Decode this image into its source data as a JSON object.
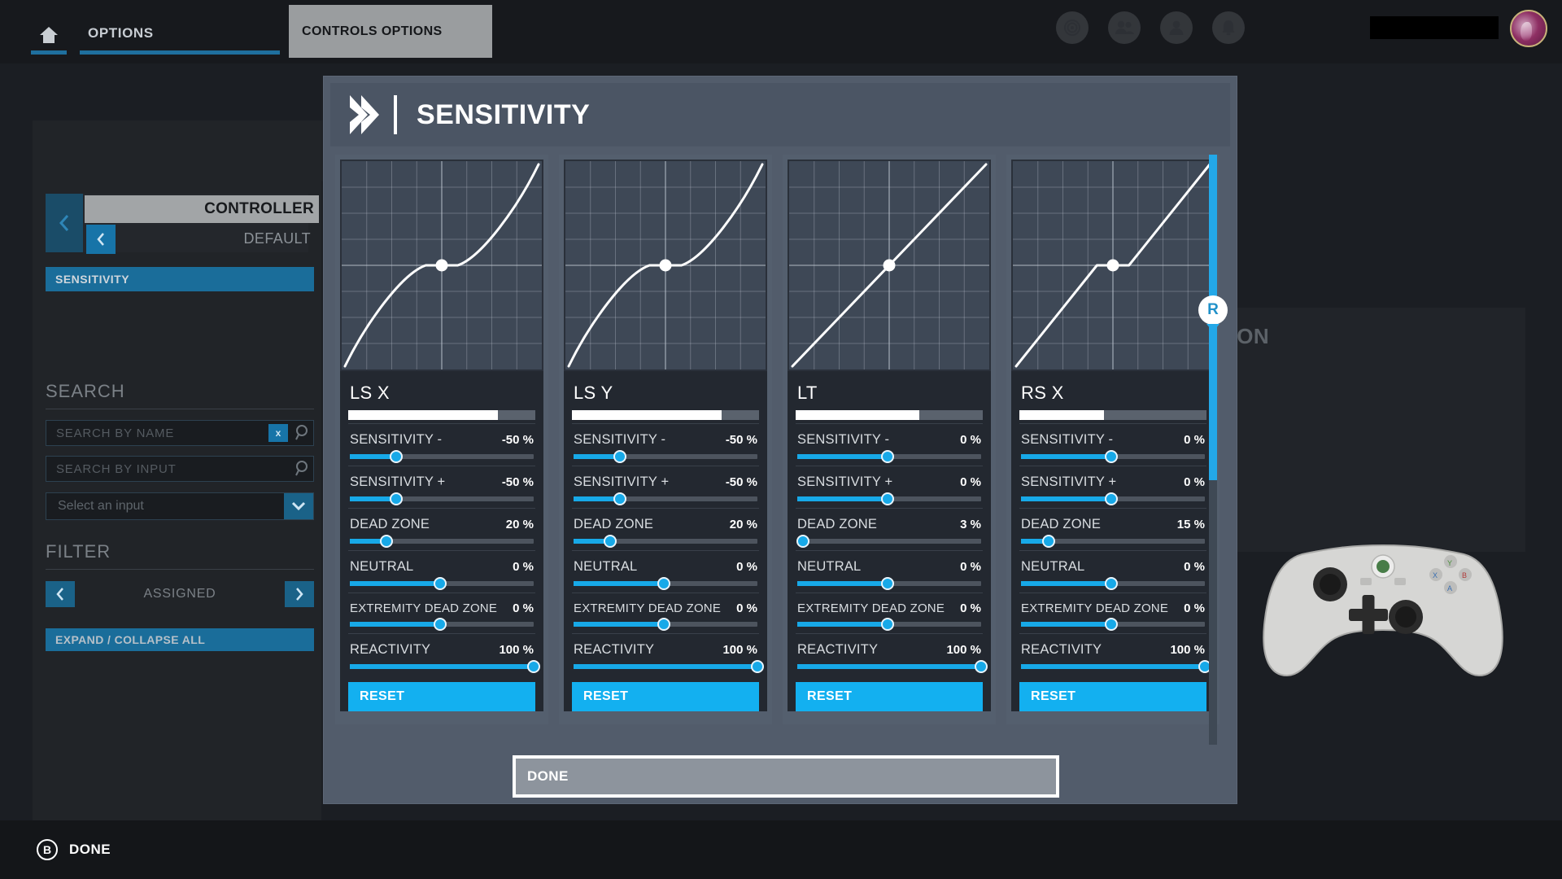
{
  "topbar": {
    "home_icon": "home-icon",
    "options_label": "OPTIONS",
    "active_tab_label": "CONTROLS OPTIONS",
    "icons": [
      "target-icon",
      "friends-icon",
      "profile-icon",
      "notification-icon"
    ]
  },
  "background": {
    "page_title": "CONTROLS O",
    "controller_label": "CONTROLLER",
    "preset_label": "DEFAULT",
    "sensitivity_label": "SENSITIVITY",
    "search_heading": "SEARCH",
    "search_by_name_placeholder": "SEARCH BY NAME",
    "search_by_input_placeholder": "SEARCH BY INPUT",
    "clear_label": "x",
    "select_input_placeholder": "Select an input",
    "filter_heading": "FILTER",
    "filter_value": "ASSIGNED",
    "expand_collapse_label": "EXPAND / COLLAPSE ALL",
    "description_label": "SCRIPTION"
  },
  "modal": {
    "title": "SENSITIVITY",
    "done_label": "DONE",
    "reset_label": "RESET",
    "scroll_hint": "R",
    "rows": [
      {
        "key": "sensitivity_minus",
        "label": "SENSITIVITY -"
      },
      {
        "key": "sensitivity_plus",
        "label": "SENSITIVITY +"
      },
      {
        "key": "dead_zone",
        "label": "DEAD ZONE"
      },
      {
        "key": "neutral",
        "label": "NEUTRAL"
      },
      {
        "key": "extremity_dead_zone",
        "label": "EXTREMITY DEAD ZONE"
      },
      {
        "key": "reactivity",
        "label": "REACTIVITY"
      }
    ],
    "cards": [
      {
        "name": "LS X",
        "meter_percent": 80,
        "values": {
          "sensitivity_minus": "-50 %",
          "sensitivity_plus": "-50 %",
          "dead_zone": "20 %",
          "neutral": "0 %",
          "extremity_dead_zone": "0 %",
          "reactivity": "100 %"
        },
        "knobs": {
          "sensitivity_minus": 25,
          "sensitivity_plus": 25,
          "dead_zone": 20,
          "neutral": 49,
          "extremity_dead_zone": 49,
          "reactivity": 100
        },
        "curve": "concave",
        "node_x": 0.5,
        "node_y": 0.5
      },
      {
        "name": "LS Y",
        "meter_percent": 80,
        "values": {
          "sensitivity_minus": "-50 %",
          "sensitivity_plus": "-50 %",
          "dead_zone": "20 %",
          "neutral": "0 %",
          "extremity_dead_zone": "0 %",
          "reactivity": "100 %"
        },
        "knobs": {
          "sensitivity_minus": 25,
          "sensitivity_plus": 25,
          "dead_zone": 20,
          "neutral": 49,
          "extremity_dead_zone": 49,
          "reactivity": 100
        },
        "curve": "concave",
        "node_x": 0.5,
        "node_y": 0.5
      },
      {
        "name": "LT",
        "meter_percent": 66,
        "values": {
          "sensitivity_minus": "0 %",
          "sensitivity_plus": "0 %",
          "dead_zone": "3 %",
          "neutral": "0 %",
          "extremity_dead_zone": "0 %",
          "reactivity": "100 %"
        },
        "knobs": {
          "sensitivity_minus": 49,
          "sensitivity_plus": 49,
          "dead_zone": 3,
          "neutral": 49,
          "extremity_dead_zone": 49,
          "reactivity": 100
        },
        "curve": "linear",
        "node_x": 0.5,
        "node_y": 0.5
      },
      {
        "name": "RS X",
        "meter_percent": 45,
        "values": {
          "sensitivity_minus": "0 %",
          "sensitivity_plus": "0 %",
          "dead_zone": "15 %",
          "neutral": "0 %",
          "extremity_dead_zone": "0 %",
          "reactivity": "100 %"
        },
        "knobs": {
          "sensitivity_minus": 49,
          "sensitivity_plus": 49,
          "dead_zone": 15,
          "neutral": 49,
          "extremity_dead_zone": 49,
          "reactivity": 100
        },
        "curve": "linear-deadzone",
        "node_x": 0.5,
        "node_y": 0.5
      }
    ]
  },
  "footer": {
    "button_glyph": "B",
    "label": "DONE"
  },
  "colors": {
    "accent_blue": "#13b0f0",
    "slider_blue": "#17a9e8",
    "panel_blue_grey": "#525c6b",
    "card_bg": "#232830",
    "graph_bg": "#3e4856"
  }
}
